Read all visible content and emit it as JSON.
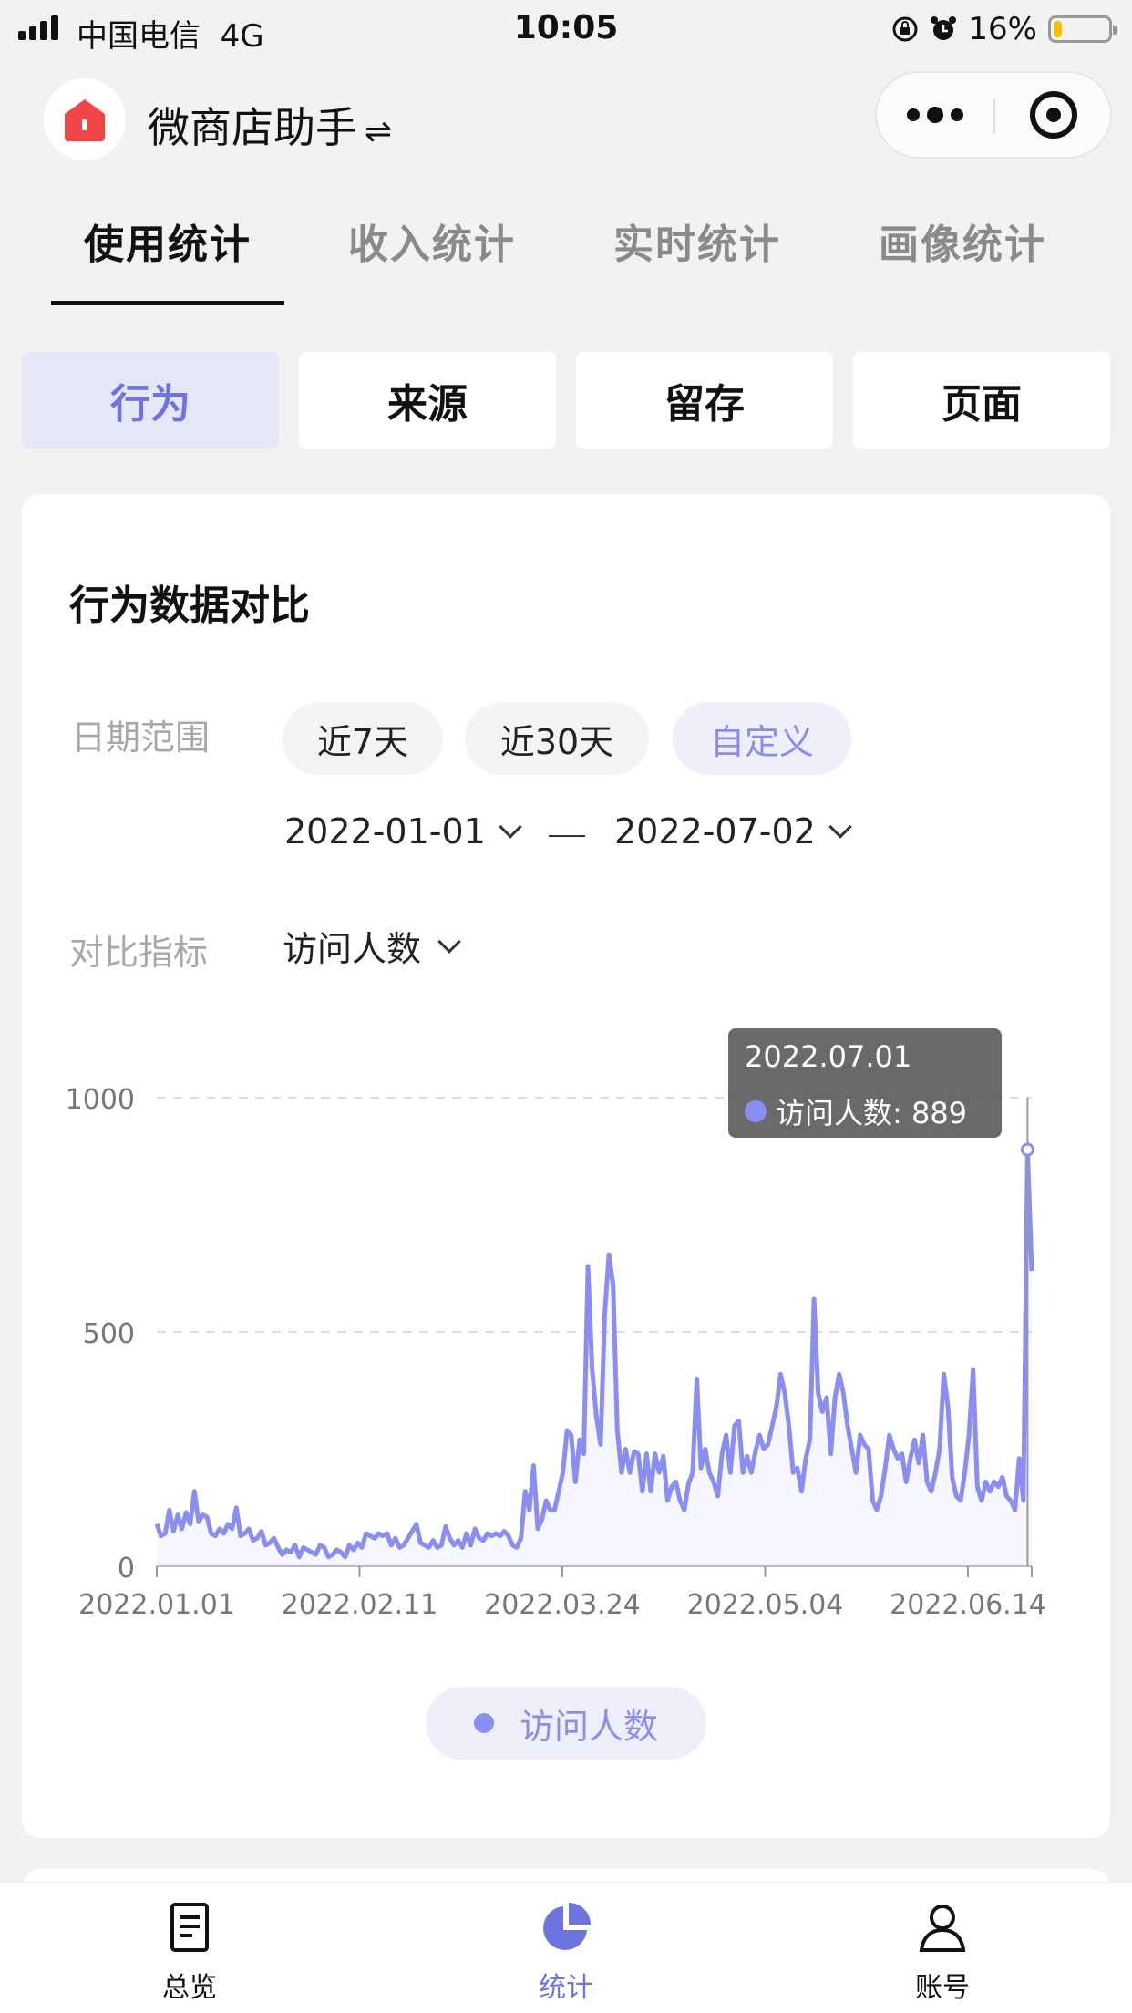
{
  "status_bar": {
    "carrier": "中国电信",
    "network": "4G",
    "time": "10:05",
    "battery": "16%",
    "battery_level": 0.16
  },
  "header": {
    "title": "微商店助手",
    "swap_symbol": "⇌",
    "logo_icon": "shop-house-icon",
    "brand_color": "#f04646"
  },
  "tabs": [
    {
      "label": "使用统计",
      "active": true
    },
    {
      "label": "收入统计",
      "active": false
    },
    {
      "label": "实时统计",
      "active": false
    },
    {
      "label": "画像统计",
      "active": false
    }
  ],
  "segments": [
    {
      "label": "行为",
      "active": true
    },
    {
      "label": "来源",
      "active": false
    },
    {
      "label": "留存",
      "active": false
    },
    {
      "label": "页面",
      "active": false
    }
  ],
  "card": {
    "title": "行为数据对比",
    "date_range_label": "日期范围",
    "ranges": [
      {
        "label": "近7天",
        "active": false
      },
      {
        "label": "近30天",
        "active": false
      },
      {
        "label": "自定义",
        "active": true
      }
    ],
    "start_date": "2022-01-01",
    "end_date": "2022-07-02",
    "metric_label": "对比指标",
    "metric_value": "访问人数"
  },
  "chart_data": {
    "type": "area",
    "series_color": "#8a8ef0",
    "y_ticks": [
      "0",
      "500",
      "1000"
    ],
    "ylim": [
      0,
      1000
    ],
    "x_tick_labels": [
      "2022.01.01",
      "2022.02.11",
      "2022.03.24",
      "2022.05.04",
      "2022.06.14"
    ],
    "x_range": [
      "2022.01.01",
      "2022.07.02"
    ],
    "grid": true,
    "legend_position": "bottom-center",
    "series": [
      {
        "name": "访问人数",
        "values": [
          90,
          65,
          70,
          120,
          75,
          110,
          80,
          115,
          90,
          160,
          95,
          110,
          105,
          70,
          65,
          80,
          70,
          90,
          80,
          125,
          65,
          70,
          80,
          55,
          60,
          75,
          45,
          50,
          60,
          40,
          25,
          35,
          30,
          45,
          20,
          40,
          35,
          30,
          25,
          45,
          40,
          20,
          25,
          35,
          30,
          20,
          45,
          35,
          50,
          40,
          70,
          65,
          60,
          70,
          65,
          70,
          45,
          60,
          40,
          45,
          60,
          75,
          90,
          50,
          45,
          40,
          55,
          40,
          45,
          85,
          60,
          45,
          55,
          40,
          70,
          45,
          80,
          60,
          55,
          70,
          65,
          70,
          65,
          75,
          65,
          45,
          40,
          60,
          160,
          120,
          215,
          80,
          100,
          140,
          120,
          120,
          160,
          200,
          290,
          280,
          180,
          270,
          240,
          640,
          420,
          320,
          260,
          540,
          665,
          600,
          290,
          200,
          250,
          200,
          245,
          240,
          160,
          240,
          160,
          240,
          200,
          235,
          140,
          170,
          180,
          140,
          120,
          175,
          200,
          400,
          210,
          250,
          200,
          180,
          150,
          240,
          280,
          200,
          300,
          310,
          200,
          235,
          200,
          245,
          280,
          250,
          260,
          300,
          340,
          410,
          370,
          300,
          200,
          210,
          160,
          230,
          270,
          570,
          370,
          330,
          360,
          240,
          360,
          410,
          370,
          300,
          250,
          200,
          280,
          260,
          250,
          140,
          120,
          150,
          210,
          280,
          250,
          230,
          240,
          180,
          230,
          270,
          220,
          280,
          180,
          160,
          200,
          250,
          410,
          340,
          190,
          150,
          140,
          200,
          280,
          420,
          170,
          140,
          180,
          160,
          180,
          170,
          190,
          150,
          140,
          120,
          230,
          140,
          889,
          630
        ]
      }
    ],
    "tooltip": {
      "date": "2022.07.01",
      "series_name": "访问人数",
      "value": 889,
      "text": "访问人数: 889"
    }
  },
  "bottom_nav": [
    {
      "label": "总览",
      "icon": "document-icon",
      "active": false
    },
    {
      "label": "统计",
      "icon": "pie-chart-icon",
      "active": true
    },
    {
      "label": "账号",
      "icon": "user-icon",
      "active": false
    }
  ],
  "colors": {
    "accent": "#6e73e0",
    "accent_light": "#e6e7f6",
    "background": "#f2f2f3"
  }
}
